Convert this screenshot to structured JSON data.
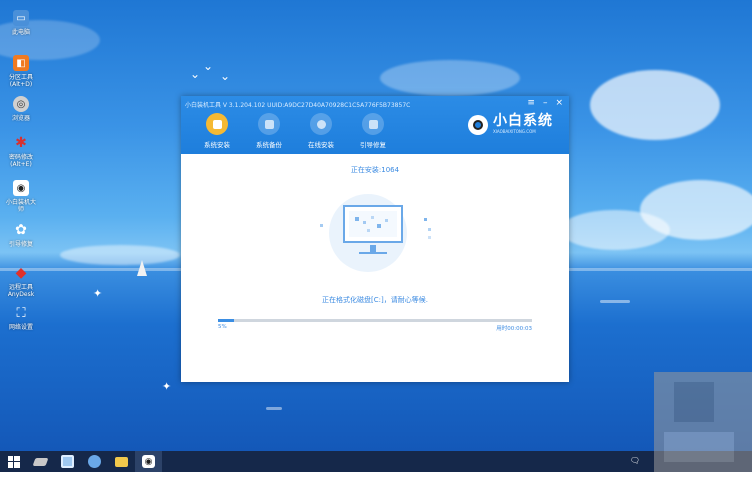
{
  "desktop": {
    "icons": [
      {
        "label": "此电脑",
        "icon": "computer-icon",
        "color": "#4a90d9"
      },
      {
        "label": "分区工具\n(Alt+D)",
        "icon": "partition-tool-icon",
        "color": "#f07a20"
      },
      {
        "label": "浏览器",
        "icon": "browser-icon",
        "color": "#d0d0d0"
      },
      {
        "label": "密码修改\n(Alt+E)",
        "icon": "password-icon",
        "color": "#d83030"
      },
      {
        "label": "小白装机大\n师",
        "icon": "installer-icon",
        "color": "#222222"
      },
      {
        "label": "引导修复",
        "icon": "boot-repair-icon",
        "color": "#3aa0e8"
      },
      {
        "label": "远程工具\nAnyDesk",
        "icon": "anydesk-icon",
        "color": "#e0302a"
      },
      {
        "label": "网络设置",
        "icon": "network-icon",
        "color": "#ffffff"
      }
    ]
  },
  "window": {
    "title": "小白装机工具 V 3.1.204.102 UUID:A9DC27D40A70928C1C5A776F5B73857C",
    "controls": {
      "menu": "≡",
      "minimize": "–",
      "close": "×"
    },
    "tabs": [
      {
        "label": "系统安装",
        "icon": "system-install-icon",
        "active": true
      },
      {
        "label": "系统备份",
        "icon": "system-backup-icon",
        "active": false
      },
      {
        "label": "在线安装",
        "icon": "online-install-icon",
        "active": false
      },
      {
        "label": "引导修复",
        "icon": "boot-repair-icon",
        "active": false
      }
    ],
    "logo": {
      "title": "小白系统",
      "subtitle": "XIAOBAIXITONG.COM"
    },
    "status_title": "正在安装:1064",
    "message": "正在格式化磁盘[C:]，请耐心等候.",
    "progress": {
      "percent_label": "5%",
      "value": 0.05,
      "elapsed": "用时00:00:03"
    }
  },
  "taskbar": {
    "items": [
      {
        "icon": "start-icon",
        "active": false
      },
      {
        "icon": "eraser-icon",
        "active": false
      },
      {
        "icon": "computer-icon",
        "active": false
      },
      {
        "icon": "network-icon",
        "active": false
      },
      {
        "icon": "folder-icon",
        "active": false
      },
      {
        "icon": "installer-icon",
        "active": true
      }
    ],
    "tray_icon": "notification-icon"
  },
  "colors": {
    "accent": "#1e7edc",
    "active_tab": "#f5b933",
    "text_blue": "#3c8be2",
    "taskbar": "#15284a"
  }
}
